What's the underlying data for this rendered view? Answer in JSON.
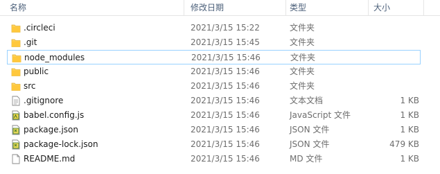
{
  "columns": {
    "name": "名称",
    "date_modified": "修改日期",
    "type": "类型",
    "size": "大小"
  },
  "files": [
    {
      "name": ".circleci",
      "date": "2021/3/15 15:22",
      "type": "文件夹",
      "size": "",
      "icon": "folder-icon"
    },
    {
      "name": ".git",
      "date": "2021/3/15 15:45",
      "type": "文件夹",
      "size": "",
      "icon": "folder-icon"
    },
    {
      "name": "node_modules",
      "date": "2021/3/15 15:46",
      "type": "文件夹",
      "size": "",
      "icon": "folder-icon"
    },
    {
      "name": "public",
      "date": "2021/3/15 15:46",
      "type": "文件夹",
      "size": "",
      "icon": "folder-icon"
    },
    {
      "name": "src",
      "date": "2021/3/15 15:46",
      "type": "文件夹",
      "size": "",
      "icon": "folder-icon"
    },
    {
      "name": ".gitignore",
      "date": "2021/3/15 15:46",
      "type": "文本文档",
      "size": "1 KB",
      "icon": "text-file-icon"
    },
    {
      "name": "babel.config.js",
      "date": "2021/3/15 15:46",
      "type": "JavaScript 文件",
      "size": "1 KB",
      "icon": "js-file-icon"
    },
    {
      "name": "package.json",
      "date": "2021/3/15 15:46",
      "type": "JSON 文件",
      "size": "1 KB",
      "icon": "json-file-icon"
    },
    {
      "name": "package-lock.json",
      "date": "2021/3/15 15:46",
      "type": "JSON 文件",
      "size": "479 KB",
      "icon": "json-file-icon"
    },
    {
      "name": "README.md",
      "date": "2021/3/15 15:46",
      "type": "MD 文件",
      "size": "1 KB",
      "icon": "blank-file-icon"
    }
  ],
  "selected_row": 2
}
